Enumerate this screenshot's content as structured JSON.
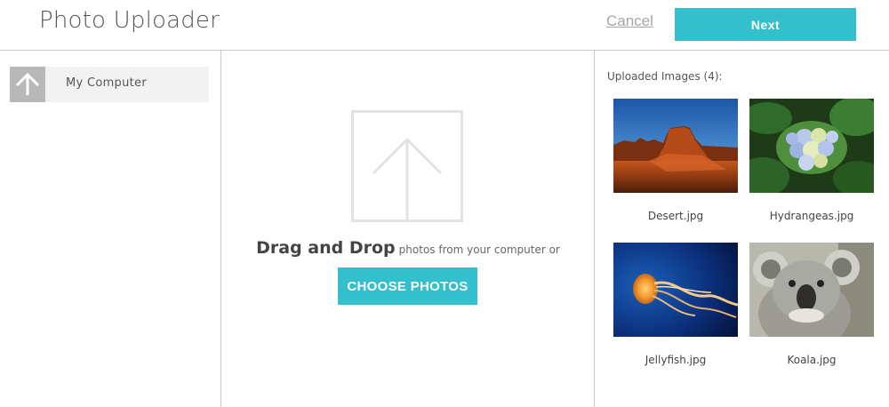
{
  "header": {
    "title": "Photo Uploader",
    "cancel_label": "Cancel",
    "next_label": "Next"
  },
  "sidebar": {
    "items": [
      {
        "label": "My Computer",
        "icon": "upload-arrow-icon"
      }
    ]
  },
  "dropzone": {
    "icon": "upload-arrow-icon",
    "drag_strong": "Drag and Drop",
    "drag_rest": "photos from your computer or",
    "choose_label": "CHOOSE PHOTOS"
  },
  "uploaded": {
    "heading": "Uploaded Images (4):",
    "images": [
      {
        "name": "Desert.jpg"
      },
      {
        "name": "Hydrangeas.jpg"
      },
      {
        "name": "Jellyfish.jpg"
      },
      {
        "name": "Koala.jpg"
      }
    ]
  },
  "colors": {
    "accent": "#33bfcc",
    "border": "#c9c9c9",
    "sidebar_item_bg": "#f2f2f2",
    "icon_box_bg": "#b8b8b8"
  }
}
